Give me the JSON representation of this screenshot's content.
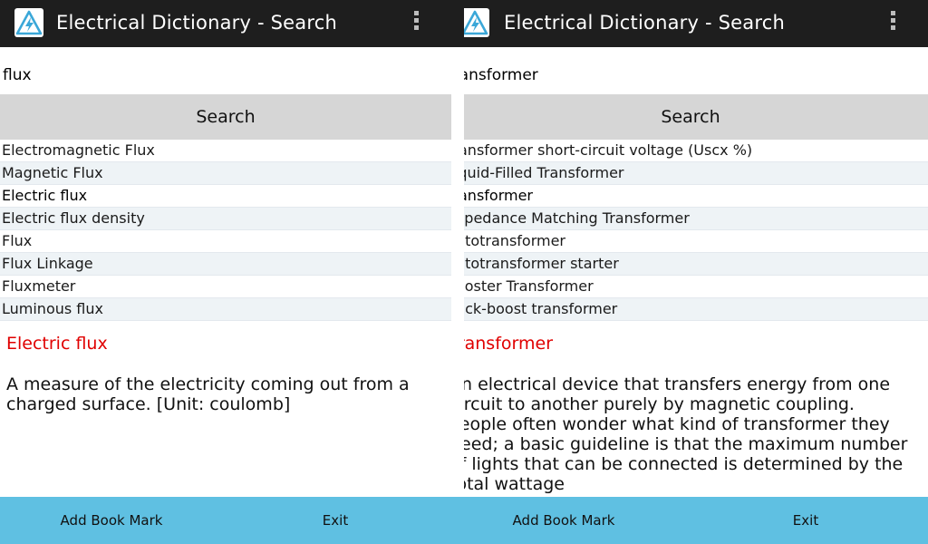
{
  "panes": [
    {
      "app_title": "Electrical Dictionary - Search",
      "search": {
        "value": "flux"
      },
      "search_button_label": "Search",
      "results": [
        "Electromagnetic Flux",
        "Magnetic Flux",
        "Electric flux",
        "Electric flux density",
        "Flux",
        "Flux Linkage",
        "Fluxmeter",
        "Luminous flux"
      ],
      "detail": {
        "term": "Electric flux",
        "definition": "A measure of the electricity coming out from a charged surface. [Unit: coulomb]"
      },
      "bottom": {
        "bookmark_label": "Add Book Mark",
        "exit_label": "Exit"
      }
    },
    {
      "app_title": "Electrical Dictionary - Search",
      "search": {
        "value": "transformer"
      },
      "search_button_label": "Search",
      "results": [
        "Transformer short-circuit voltage (Uscx %)",
        "Liquid-Filled Transformer",
        "Transformer",
        "Impedance Matching Transformer",
        "Autotransformer",
        "Autotransformer starter",
        "Booster Transformer",
        "Buck-boost transformer"
      ],
      "detail": {
        "term": "Transformer",
        "definition": "An electrical device that transfers energy from one circuit to another purely by magnetic coupling. People often wonder what kind of transformer they need; a basic guideline is that the maximum number of lights that can be connected is determined by the total wattage"
      },
      "bottom": {
        "bookmark_label": "Add Book Mark",
        "exit_label": "Exit"
      }
    }
  ],
  "colors": {
    "appbar": "#1e1e1e",
    "search_button": "#d6d6d6",
    "row_alt": "#eef3f6",
    "term": "#e00000",
    "bottom_bar": "#5fc0e2",
    "icon_accent": "#3aa7d8"
  },
  "icons": {
    "app": "lightning-triangle-icon",
    "menu": "overflow-menu-icon"
  }
}
